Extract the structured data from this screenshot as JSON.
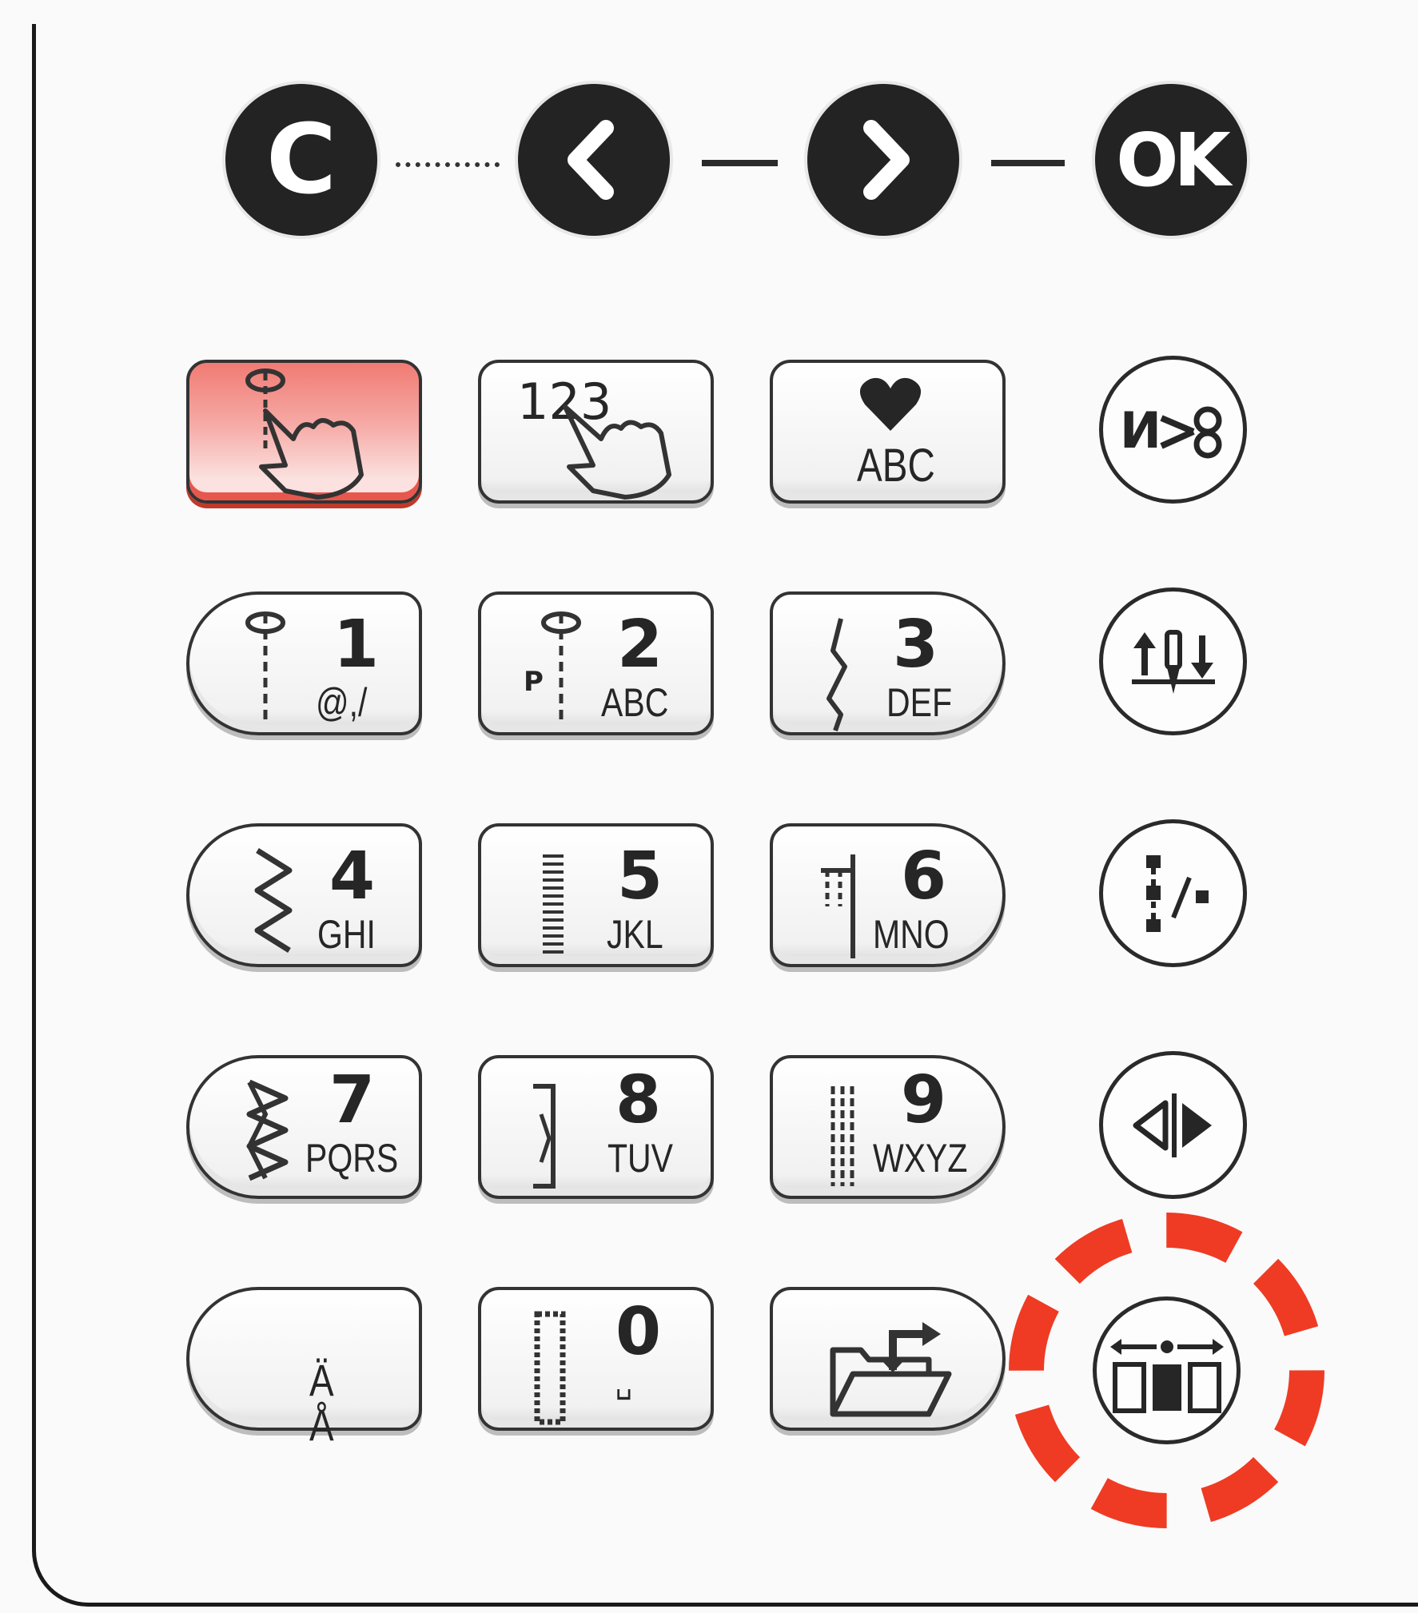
{
  "colors": {
    "active_key": "#f6aaa6",
    "highlight": "#ef3b24",
    "dark": "#232323"
  },
  "nav": {
    "clear_label": "C",
    "prev_label": "❮",
    "next_label": "❯",
    "ok_label": "OK"
  },
  "top_keys": {
    "stitch_select_icon": "hand-pointer-stitch-icon",
    "number_entry_label": "123",
    "number_entry_icon": "hand-pointer-icon",
    "alphabet_heart_icon": "heart-icon",
    "alphabet_label": "ABC"
  },
  "keypad": [
    {
      "digit": "1",
      "letters": "@,/",
      "icon": "straight-stitch-needle-icon"
    },
    {
      "digit": "2",
      "letters": "ABC",
      "icon": "pfaff-needle-stitch-icon",
      "prefix": "P"
    },
    {
      "digit": "3",
      "letters": "DEF",
      "icon": "stretch-stitch-icon"
    },
    {
      "digit": "4",
      "letters": "GHI",
      "icon": "zigzag-stitch-icon"
    },
    {
      "digit": "5",
      "letters": "JKL",
      "icon": "satin-stitch-icon"
    },
    {
      "digit": "6",
      "letters": "MNO",
      "icon": "blind-hem-stitch-icon"
    },
    {
      "digit": "7",
      "letters": "PQRS",
      "icon": "decorative-stitch-icon"
    },
    {
      "digit": "8",
      "letters": "TUV",
      "icon": "quilt-stitch-icon"
    },
    {
      "digit": "9",
      "letters": "WXYZ",
      "icon": "triple-stitch-icon"
    },
    {
      "special": "Ä Å",
      "icon": "special-characters"
    },
    {
      "digit": "0",
      "letters": "␣",
      "icon": "buttonhole-stitch-icon"
    },
    {
      "icon": "folder-load-icon"
    }
  ],
  "right_buttons": [
    {
      "name": "thread-cutter-button",
      "icon": "thread-cutter-icon"
    },
    {
      "name": "needle-up-down-button",
      "icon": "needle-up-down-icon"
    },
    {
      "name": "tie-off-button",
      "icon": "tie-off-icon"
    },
    {
      "name": "mirror-button",
      "icon": "mirror-side-to-side-icon"
    },
    {
      "name": "stitch-width-position-button",
      "icon": "stitch-position-icon",
      "highlighted": true
    }
  ]
}
